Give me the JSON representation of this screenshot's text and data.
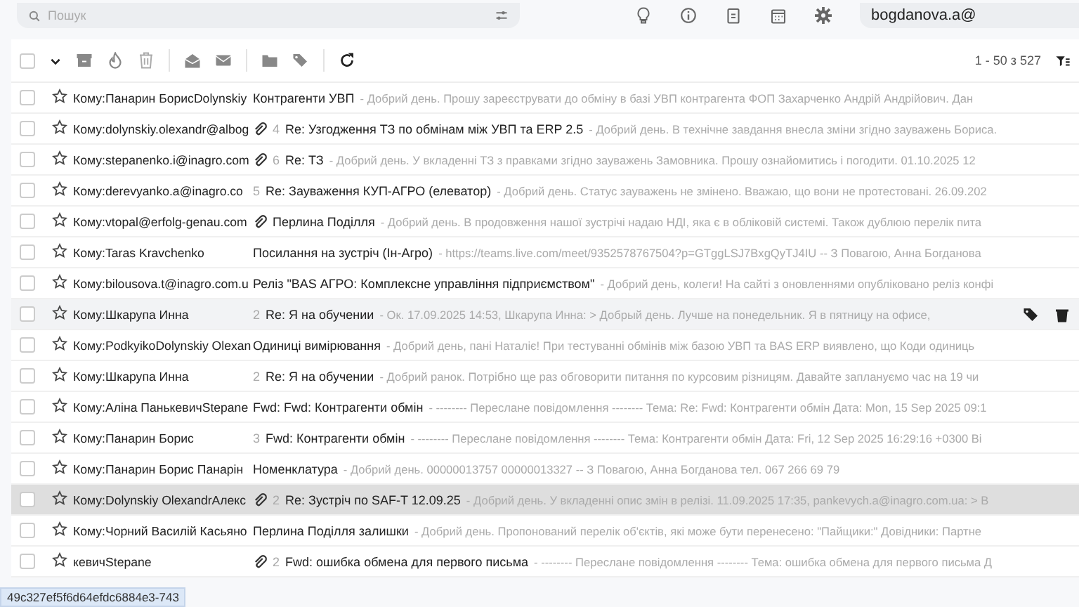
{
  "search": {
    "placeholder": "Пошук"
  },
  "account": "bogdanova.a@",
  "pager": "1 - 50 з 527",
  "select_all": {
    "checked": false
  },
  "rows": [
    {
      "recipient": "Кому:Панарин БорисDolynskiy",
      "attachment": false,
      "subject": "Контрагенти УВП",
      "preview": "- Добрий день. Прошу зареєструвати до обміну в базі УВП контрагента ФОП Захарченко Андрій Андрійович. Дан",
      "checked": false,
      "hovered": false,
      "selected": false
    },
    {
      "recipient": "Кому:dolynskiy.olexandr@albog",
      "attachment": true,
      "count": "4",
      "subject": "Re: Узгодження ТЗ по обмінам між УВП та ERP 2.5",
      "preview": "- Добрий день. В технічне завдання внесла зміни згідно зауважень Бориса.",
      "checked": false,
      "hovered": false,
      "selected": false
    },
    {
      "recipient": "Кому:stepanenko.i@inagro.com",
      "attachment": true,
      "count": "6",
      "subject": "Re: ТЗ",
      "preview": "- Добрий день. У вкладенні ТЗ з правками згідно зауважень Замовника. Прошу ознайомитись і погодити. 01.10.2025 12",
      "checked": false,
      "hovered": false,
      "selected": false
    },
    {
      "recipient": "Кому:derevyanko.a@inagro.co",
      "attachment": false,
      "count": "5",
      "subject": "Re: Зауваження КУП-АГРО (елеватор)",
      "preview": "- Добрий день. Статус зауважень не змінено. Вважаю, що вони не протестовані. 26.09.202",
      "checked": false,
      "hovered": false,
      "selected": false
    },
    {
      "recipient": "Кому:vtopal@erfolg-genau.com",
      "attachment": true,
      "subject": "Перлина Поділля",
      "preview": "- Добрий день. В продовження нашої зустрічі надаю НДІ, яка є в обліковій системі. Також дублюю перелік пита",
      "checked": false,
      "hovered": false,
      "selected": false
    },
    {
      "recipient": "Кому:Taras Kravchenko",
      "attachment": false,
      "subject": "Посилання на зустріч (Ін-Агро)",
      "preview": "- https://teams.live.com/meet/9352578767504?p=GTggLSJ7BxgQyTJ4IU -- З Повагою, Анна Богданова",
      "checked": false,
      "hovered": false,
      "selected": false
    },
    {
      "recipient": "Кому:bilousova.t@inagro.com.u",
      "attachment": false,
      "subject": "Реліз \"BAS АГРО: Комплексне управління підприємством\"",
      "preview": "- Добрий день, колеги! На сайті з оновленнями опубліковано реліз конфі",
      "checked": false,
      "hovered": false,
      "selected": false
    },
    {
      "recipient": "Кому:Шкарупа Инна",
      "attachment": false,
      "count": "2",
      "subject": "Re: Я на обучении",
      "preview": "- Ок. 17.09.2025 14:53, Шкарупа Инна: > Добрый день. Лучше на понедельник. Я в пятницу на офисе,",
      "checked": false,
      "hovered": true,
      "selected": false
    },
    {
      "recipient": "Кому:PodkyikoDolynskiy Olexan",
      "attachment": false,
      "subject": "Одиниці вимірювання",
      "preview": "- Добрий день, пані Наталіє! При тестуванні обмінів між базою УВП та BAS ERP виявлено, що Коди одиниць",
      "checked": false,
      "hovered": false,
      "selected": false
    },
    {
      "recipient": "Кому:Шкарупа Инна",
      "attachment": false,
      "count": "2",
      "subject": "Re: Я на обучении",
      "preview": "- Добрий ранок. Потрібно ще раз обговорити питання по курсовим різницям. Давайте заплануємо час на 19 чи",
      "checked": false,
      "hovered": false,
      "selected": false
    },
    {
      "recipient": "Кому:Аліна ПанькевичStepane",
      "attachment": false,
      "subject": "Fwd: Fwd: Контрагенти обмін",
      "preview": "- -------- Переслане повідомлення -------- Тема: Re: Fwd: Контрагенти обмін Дата: Mon, 15 Sep 2025 09:1",
      "checked": false,
      "hovered": false,
      "selected": false
    },
    {
      "recipient": "Кому:Панарин Борис",
      "attachment": false,
      "count": "3",
      "subject": "Fwd: Контрагенти обмін",
      "preview": "- -------- Переслане повідомлення -------- Тема: Контрагенти обмін Дата: Fri, 12 Sep 2025 16:29:16 +0300 Ві",
      "checked": false,
      "hovered": false,
      "selected": false
    },
    {
      "recipient": "Кому:Панарин Борис Панарін",
      "attachment": false,
      "subject": "Номенклатура",
      "preview": "- Добрий день. 00000013757 00000013327 -- З Повагою, Анна Богданова тел. 067 266 69 79",
      "checked": false,
      "hovered": false,
      "selected": false
    },
    {
      "recipient": "Кому:Dolynskiy OlexandrАлекс",
      "attachment": true,
      "count": "2",
      "subject": "Re: Зустріч по SAF-T 12.09.25",
      "preview": "- Добрий день. У вкладенні опис змін в релізі. 11.09.2025 17:35, pankevych.a@inagro.com.ua: > В",
      "checked": false,
      "hovered": false,
      "selected": true
    },
    {
      "recipient": "Кому:Чорний Василій Касьяно",
      "attachment": false,
      "subject": "Перлина Поділля залишки",
      "preview": "- Добрий день. Пропонований перелік об'єктів, які може бути перенесено: \"Пайщики:\" Довідники: Партне",
      "checked": false,
      "hovered": false,
      "selected": false
    },
    {
      "recipient": "кевичStepane",
      "attachment": true,
      "count": "2",
      "subject": "Fwd: ошибка обмена для первого письма",
      "preview": "- -------- Переслане повідомлення -------- Тема: ошибка обмена для первого письма Д",
      "checked": false,
      "hovered": false,
      "selected": false
    }
  ],
  "status_link": "49c327ef5f6d64efdc6884e3-743"
}
